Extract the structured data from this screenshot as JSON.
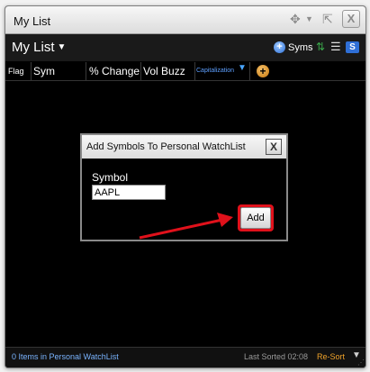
{
  "window": {
    "title": "My List"
  },
  "toolbar": {
    "list_title": "My List",
    "syms_label": "Syms",
    "s_label": "S"
  },
  "columns": [
    "Flag",
    "Sym",
    "% Change",
    "Vol Buzz",
    "Capitalization"
  ],
  "dialog": {
    "title": "Add Symbols To Personal WatchList",
    "close_label": "X",
    "symbol_label": "Symbol",
    "symbol_value": "AAPL",
    "add_label": "Add"
  },
  "status": {
    "count_text": "0 Items in Personal WatchList",
    "last_sorted": "Last Sorted 02:08",
    "resort": "Re-Sort"
  },
  "colors": {
    "highlight": "#e0111b",
    "resort": "#f0a32a",
    "accent": "#2f6fd6"
  }
}
